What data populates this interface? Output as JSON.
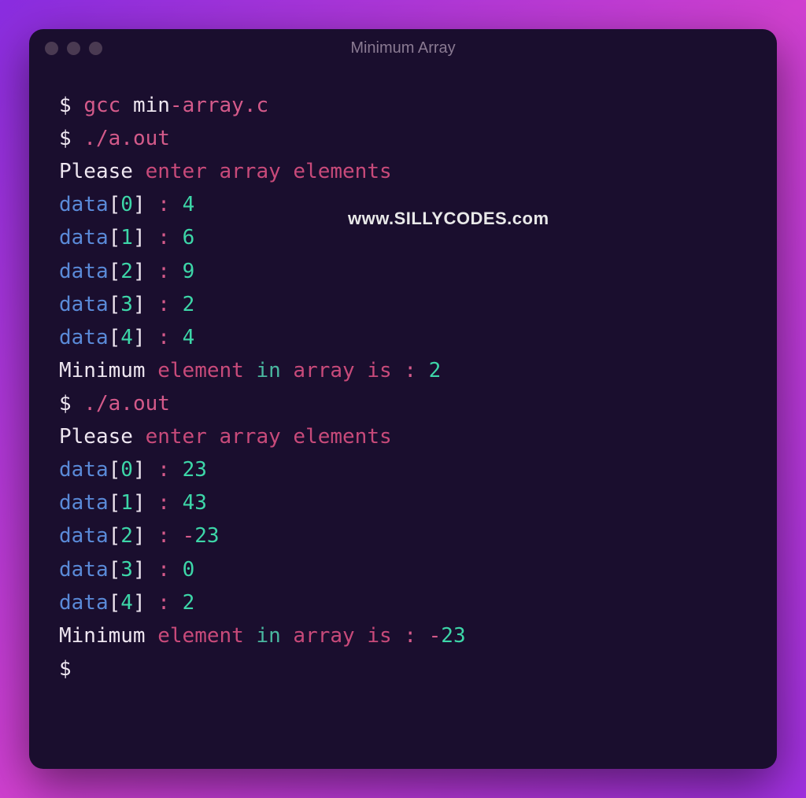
{
  "window": {
    "title": "Minimum Array"
  },
  "watermark": "www.SILLYCODES.com",
  "terminal": {
    "prompt": "$",
    "commands": {
      "compile": "gcc min-array.c",
      "compile_cmd": "gcc",
      "compile_arg1": "min",
      "compile_dash": "-",
      "compile_arg2": "array",
      "compile_dot": ".",
      "compile_ext": "c",
      "run_dot": ".",
      "run_slash": "/",
      "run_a": "a",
      "run_dot2": ".",
      "run_out": "out"
    },
    "prompts": {
      "please": "Please",
      "enter": " enter",
      "array": " array",
      "elements": " elements"
    },
    "run1": {
      "inputs": [
        {
          "label": "data",
          "lb": "[",
          "idx": "0",
          "rb": "]",
          "colon": " : ",
          "value": "4"
        },
        {
          "label": "data",
          "lb": "[",
          "idx": "1",
          "rb": "]",
          "colon": " : ",
          "value": "6"
        },
        {
          "label": "data",
          "lb": "[",
          "idx": "2",
          "rb": "]",
          "colon": " : ",
          "value": "9"
        },
        {
          "label": "data",
          "lb": "[",
          "idx": "3",
          "rb": "]",
          "colon": " : ",
          "value": "2"
        },
        {
          "label": "data",
          "lb": "[",
          "idx": "4",
          "rb": "]",
          "colon": " : ",
          "value": "4"
        }
      ],
      "result": {
        "minimum": "Minimum",
        "element": " element",
        "in": " in",
        "array": " array",
        "is": " is",
        "colon": " : ",
        "value": "2"
      }
    },
    "run2": {
      "inputs": [
        {
          "label": "data",
          "lb": "[",
          "idx": "0",
          "rb": "]",
          "colon": " : ",
          "value": "23"
        },
        {
          "label": "data",
          "lb": "[",
          "idx": "1",
          "rb": "]",
          "colon": " : ",
          "value": "43"
        },
        {
          "label": "data",
          "lb": "[",
          "idx": "2",
          "rb": "]",
          "colon": " : ",
          "neg": "-",
          "value": "23"
        },
        {
          "label": "data",
          "lb": "[",
          "idx": "3",
          "rb": "]",
          "colon": " : ",
          "value": "0"
        },
        {
          "label": "data",
          "lb": "[",
          "idx": "4",
          "rb": "]",
          "colon": " : ",
          "value": "2"
        }
      ],
      "result": {
        "minimum": "Minimum",
        "element": " element",
        "in": " in",
        "array": " array",
        "is": " is",
        "colon": " : ",
        "neg": "-",
        "value": "23"
      }
    }
  }
}
